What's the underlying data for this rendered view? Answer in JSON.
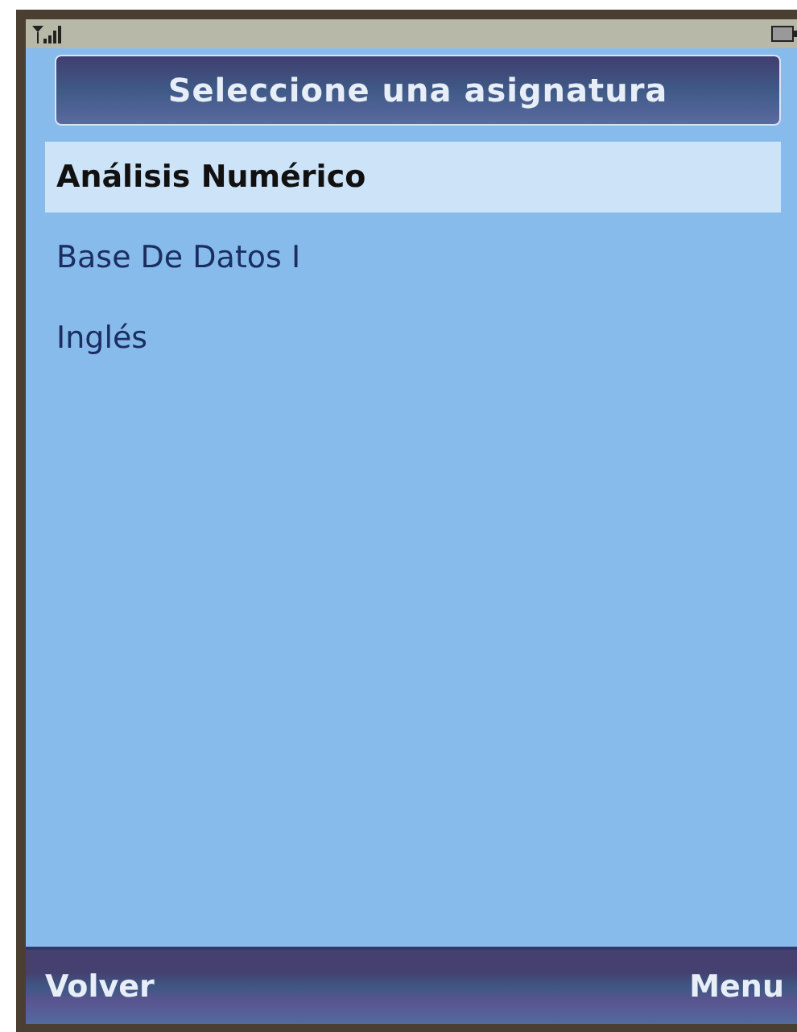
{
  "title": "Seleccione una asignatura",
  "items": [
    {
      "label": "Análisis Numérico",
      "selected": true
    },
    {
      "label": "Base De Datos I",
      "selected": false
    },
    {
      "label": "Inglés",
      "selected": false
    }
  ],
  "softkeys": {
    "left": "Volver",
    "right": "Menu"
  }
}
